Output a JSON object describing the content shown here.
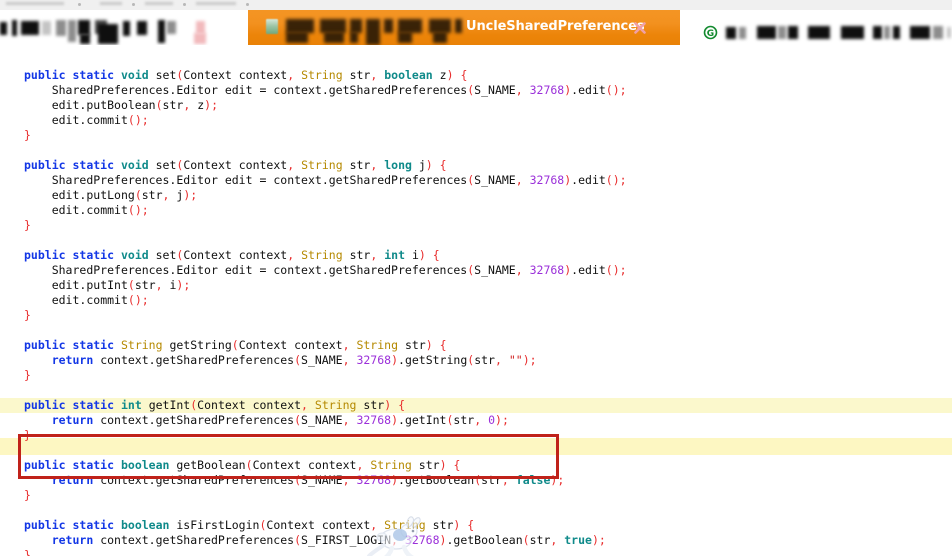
{
  "browser": {
    "tab": {
      "title": "UncleSharedPreferences",
      "favicon": "book-favicon",
      "close_label": "×"
    },
    "toolbar_icon": "green-g-circle-icon",
    "redacted_note": "blurred"
  },
  "editor": {
    "language": "java",
    "highlight": {
      "border_color": "#c0221a",
      "row_background": "#fbf8cc",
      "highlighted_line": "public static int getInt(Context context, String str) {"
    },
    "watermark": "running-rabbit-watermark",
    "colors": {
      "keyword": "#1337e6",
      "primitive_type": "#0f8a8a",
      "class_type": "#b58900",
      "number": "#9b30d9",
      "punctuation": "#e82c2c",
      "string_literal": "#d02020",
      "identifier": "#101010",
      "background": "#ffffff"
    },
    "lines": [
      {
        "i": 0,
        "blank": true,
        "text": ""
      },
      {
        "i": 1,
        "text": "public static void set(Context context, String str, boolean z) {"
      },
      {
        "i": 2,
        "text": "    SharedPreferences.Editor edit = context.getSharedPreferences(S_NAME, 32768).edit();"
      },
      {
        "i": 3,
        "text": "    edit.putBoolean(str, z);"
      },
      {
        "i": 4,
        "text": "    edit.commit();"
      },
      {
        "i": 5,
        "text": "}"
      },
      {
        "i": 6,
        "blank": true,
        "text": ""
      },
      {
        "i": 7,
        "text": "public static void set(Context context, String str, long j) {"
      },
      {
        "i": 8,
        "text": "    SharedPreferences.Editor edit = context.getSharedPreferences(S_NAME, 32768).edit();"
      },
      {
        "i": 9,
        "text": "    edit.putLong(str, j);"
      },
      {
        "i": 10,
        "text": "    edit.commit();"
      },
      {
        "i": 11,
        "text": "}"
      },
      {
        "i": 12,
        "blank": true,
        "text": ""
      },
      {
        "i": 13,
        "text": "public static void set(Context context, String str, int i) {"
      },
      {
        "i": 14,
        "text": "    SharedPreferences.Editor edit = context.getSharedPreferences(S_NAME, 32768).edit();"
      },
      {
        "i": 15,
        "text": "    edit.putInt(str, i);"
      },
      {
        "i": 16,
        "text": "    edit.commit();"
      },
      {
        "i": 17,
        "text": "}"
      },
      {
        "i": 18,
        "blank": true,
        "text": ""
      },
      {
        "i": 19,
        "text": "public static String getString(Context context, String str) {"
      },
      {
        "i": 20,
        "text": "    return context.getSharedPreferences(S_NAME, 32768).getString(str, \"\");"
      },
      {
        "i": 21,
        "text": "}"
      },
      {
        "i": 22,
        "blank": true,
        "text": ""
      },
      {
        "i": 23,
        "text": "public static int getInt(Context context, String str) {"
      },
      {
        "i": 24,
        "text": "    return context.getSharedPreferences(S_NAME, 32768).getInt(str, 0);"
      },
      {
        "i": 25,
        "text": "}"
      },
      {
        "i": 26,
        "blank": true,
        "text": ""
      },
      {
        "i": 27,
        "text": "public static boolean getBoolean(Context context, String str) {"
      },
      {
        "i": 28,
        "text": "    return context.getSharedPreferences(S_NAME, 32768).getBoolean(str, false);"
      },
      {
        "i": 29,
        "text": "}"
      },
      {
        "i": 30,
        "blank": true,
        "text": ""
      },
      {
        "i": 31,
        "text": "public static boolean isFirstLogin(Context context, String str) {"
      },
      {
        "i": 32,
        "text": "    return context.getSharedPreferences(S_FIRST_LOGIN, 32768).getBoolean(str, true);"
      },
      {
        "i": 33,
        "text": "}"
      }
    ]
  }
}
